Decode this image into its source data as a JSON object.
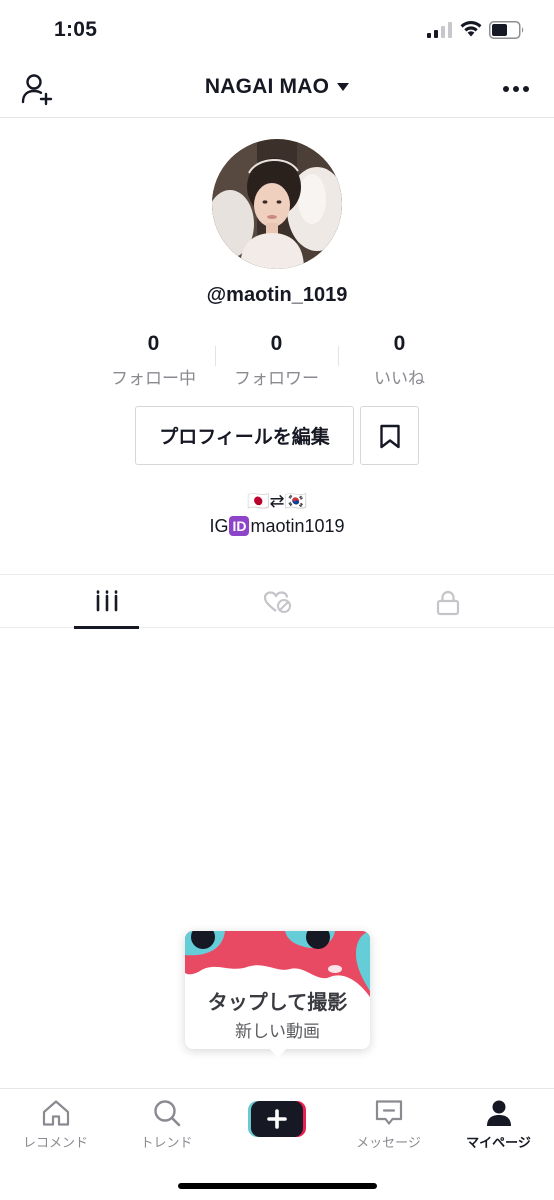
{
  "status_bar": {
    "time": "1:05"
  },
  "header": {
    "title": "NAGAI MAO"
  },
  "profile": {
    "username": "@maotin_1019",
    "stats": [
      {
        "value": "0",
        "label": "フォロー中"
      },
      {
        "value": "0",
        "label": "フォロワー"
      },
      {
        "value": "0",
        "label": "いいね"
      }
    ],
    "edit_button": "プロフィールを編集",
    "bio_line1": "🇯🇵⇄🇰🇷",
    "bio_line2_prefix": "IG",
    "bio_line2_badge": "ID",
    "bio_line2_handle": "maotin1019"
  },
  "tabs": [
    {
      "icon": "grid-icon",
      "active": true
    },
    {
      "icon": "liked-hidden-icon",
      "active": false
    },
    {
      "icon": "lock-icon",
      "active": false
    }
  ],
  "tooltip": {
    "title": "タップして撮影",
    "subtitle": "新しい動画"
  },
  "bottom_nav": [
    {
      "label": "レコメンド",
      "icon": "home-icon"
    },
    {
      "label": "トレンド",
      "icon": "search-icon"
    },
    {
      "label": "",
      "icon": "create-plus-icon"
    },
    {
      "label": "メッセージ",
      "icon": "message-icon"
    },
    {
      "label": "マイページ",
      "icon": "profile-icon",
      "active": true
    }
  ],
  "colors": {
    "accent_red": "#EE1D52",
    "accent_cyan": "#69C9D0",
    "text": "#161823",
    "muted": "#8A8B91"
  }
}
